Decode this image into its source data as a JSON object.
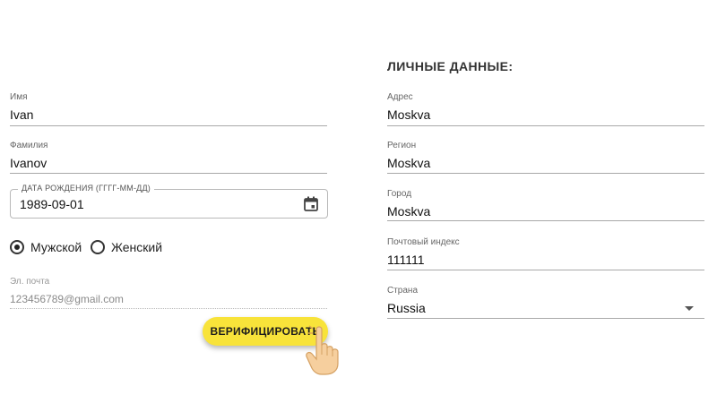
{
  "left_form": {
    "first_name": {
      "label": "Имя",
      "value": "Ivan"
    },
    "last_name": {
      "label": "Фамилия",
      "value": "Ivanov"
    },
    "birth_date": {
      "label": "ДАТА РОЖДЕНИЯ (ГГГГ-ММ-ДД)",
      "value": "1989-09-01",
      "icon": "calendar-icon"
    },
    "gender": {
      "options": [
        {
          "label": "Мужской",
          "selected": true
        },
        {
          "label": "Женский",
          "selected": false
        }
      ]
    },
    "email": {
      "label": "Эл. почта",
      "value": "123456789@gmail.com"
    },
    "verify_button": {
      "label": "ВЕРИФИЦИРОВАТЬ",
      "color": "#f8e33a"
    }
  },
  "right_form": {
    "title": "ЛИЧНЫЕ ДАННЫЕ:",
    "address": {
      "label": "Адрес",
      "value": "Moskva"
    },
    "region": {
      "label": "Регион",
      "value": "Moskva"
    },
    "city": {
      "label": "Город",
      "value": "Moskva"
    },
    "postal_code": {
      "label": "Почтовый индекс",
      "value": "111111"
    },
    "country": {
      "label": "Страна",
      "value": "Russia",
      "icon": "dropdown-arrow-icon"
    }
  },
  "pointer": {
    "icon": "hand-pointer-icon"
  }
}
